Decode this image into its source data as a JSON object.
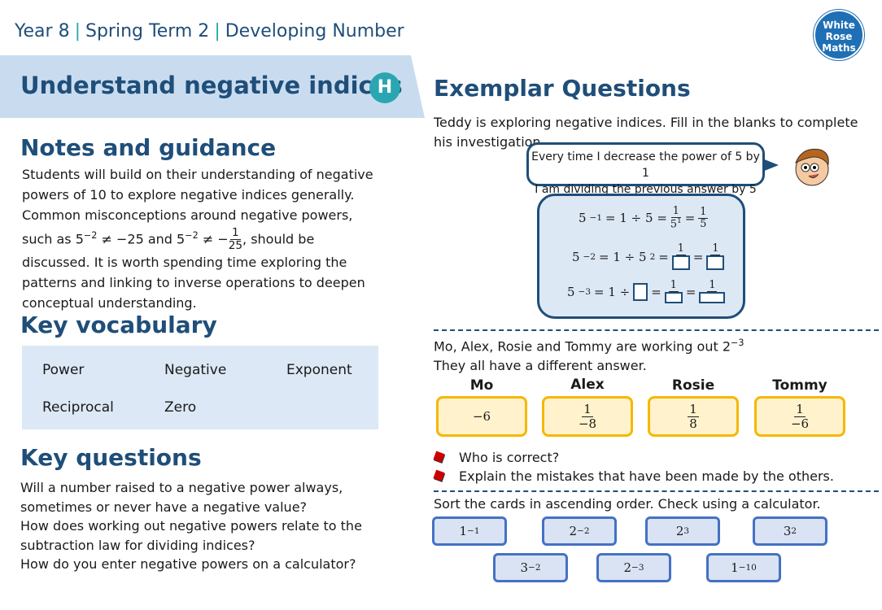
{
  "header": {
    "year": "Year 8",
    "term": "Spring Term 2",
    "unit": "Developing Number",
    "logo": [
      "White",
      "Rose",
      "Maths"
    ]
  },
  "title": "Understand negative indices",
  "badge": "H",
  "notes": {
    "heading": "Notes and guidance",
    "p1": "Students will build on their understanding of negative powers of 10 to explore negative indices generally. Common misconceptions around negative powers, such as ",
    "m1": "5",
    "m1e": "−2",
    "m1r": " ≠ −25 and ",
    "m2": "5",
    "m2e": "−2",
    "m2r": " ≠ −",
    "m2n": "1",
    "m2d": "25",
    "p2": ", should be discussed. It is worth spending time exploring the patterns and linking to inverse operations to deepen conceptual understanding."
  },
  "vocab": {
    "heading": "Key vocabulary",
    "words": [
      "Power",
      "Negative",
      "Exponent",
      "Reciprocal",
      "Zero"
    ]
  },
  "questions": {
    "heading": "Key questions",
    "items": [
      "Will a number raised to a negative power always, sometimes or never have a negative value?",
      "How does working out negative powers relate to the subtraction law for dividing indices?",
      "How do you enter negative powers on a calculator?"
    ]
  },
  "exemplar": {
    "heading": "Exemplar Questions",
    "q1": {
      "intro": "Teddy is exploring negative indices. Fill in the blanks to complete his investigation.",
      "speech": [
        "Every time I decrease the power of 5 by 1",
        "I am dividing the previous answer by 5"
      ],
      "eq1": {
        "lhs": "5",
        "exp": "−1",
        "mid": "= 1 ÷ 5 =",
        "n1": "1",
        "d1": "5",
        "d1e": "1",
        "n2": "1",
        "d2": "5"
      },
      "eq2": {
        "lhs": "5",
        "exp": "−2",
        "mid": "= 1 ÷ 5",
        "midexp": "2",
        "n1": "1",
        "n2": "1"
      },
      "eq3": {
        "lhs": "5",
        "exp": "−3",
        "mid": "= 1 ÷",
        "n1": "1",
        "n2": "1"
      }
    },
    "q2": {
      "line1": "Mo, Alex, Rosie and Tommy are working out 2",
      "line1exp": "−3",
      "line2": "They all have a different answer.",
      "people": [
        {
          "name": "Mo",
          "answer": "−6"
        },
        {
          "name": "Alex",
          "n": "1",
          "d": "−8"
        },
        {
          "name": "Rosie",
          "n": "1",
          "d": "8"
        },
        {
          "name": "Tommy",
          "n": "1",
          "d": "−6"
        }
      ],
      "bullets": [
        "Who is correct?",
        "Explain the mistakes that have been made by the others."
      ]
    },
    "q3": {
      "instruction": "Sort the cards in ascending order.  Check using a calculator.",
      "cards": [
        {
          "b": "1",
          "e": "−1"
        },
        {
          "b": "2",
          "e": "−2"
        },
        {
          "b": "2",
          "e": "3"
        },
        {
          "b": "3",
          "e": "2"
        },
        {
          "b": "3",
          "e": "−2"
        },
        {
          "b": "2",
          "e": "−3"
        },
        {
          "b": "1",
          "e": "−10"
        }
      ]
    }
  },
  "colors": {
    "navy": "#1f4e79",
    "teal": "#2aa6b2",
    "band": "#c9dcef",
    "yellow": "#f5b800",
    "cardBlue": "#4472c4"
  }
}
